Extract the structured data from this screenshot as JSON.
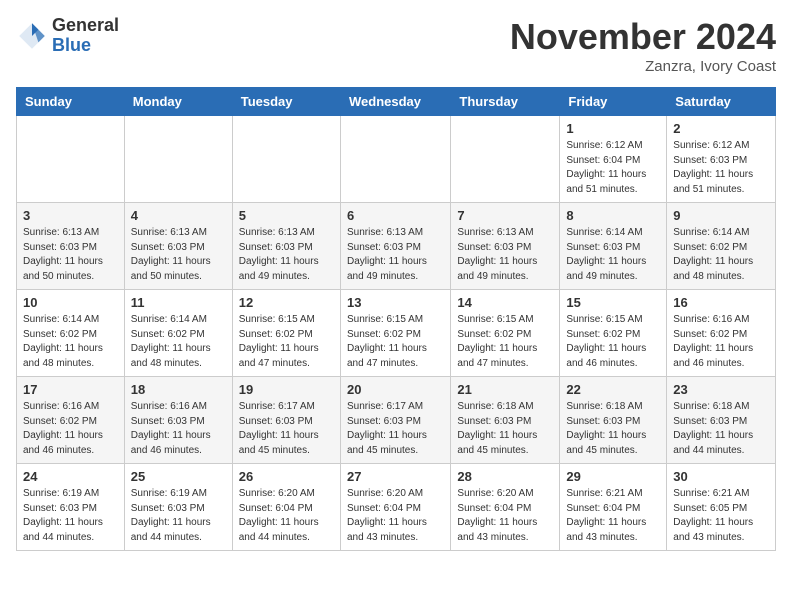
{
  "logo": {
    "general": "General",
    "blue": "Blue"
  },
  "title": "November 2024",
  "location": "Zanzra, Ivory Coast",
  "days_of_week": [
    "Sunday",
    "Monday",
    "Tuesday",
    "Wednesday",
    "Thursday",
    "Friday",
    "Saturday"
  ],
  "weeks": [
    [
      {
        "day": "",
        "info": ""
      },
      {
        "day": "",
        "info": ""
      },
      {
        "day": "",
        "info": ""
      },
      {
        "day": "",
        "info": ""
      },
      {
        "day": "",
        "info": ""
      },
      {
        "day": "1",
        "info": "Sunrise: 6:12 AM\nSunset: 6:04 PM\nDaylight: 11 hours\nand 51 minutes."
      },
      {
        "day": "2",
        "info": "Sunrise: 6:12 AM\nSunset: 6:03 PM\nDaylight: 11 hours\nand 51 minutes."
      }
    ],
    [
      {
        "day": "3",
        "info": "Sunrise: 6:13 AM\nSunset: 6:03 PM\nDaylight: 11 hours\nand 50 minutes."
      },
      {
        "day": "4",
        "info": "Sunrise: 6:13 AM\nSunset: 6:03 PM\nDaylight: 11 hours\nand 50 minutes."
      },
      {
        "day": "5",
        "info": "Sunrise: 6:13 AM\nSunset: 6:03 PM\nDaylight: 11 hours\nand 49 minutes."
      },
      {
        "day": "6",
        "info": "Sunrise: 6:13 AM\nSunset: 6:03 PM\nDaylight: 11 hours\nand 49 minutes."
      },
      {
        "day": "7",
        "info": "Sunrise: 6:13 AM\nSunset: 6:03 PM\nDaylight: 11 hours\nand 49 minutes."
      },
      {
        "day": "8",
        "info": "Sunrise: 6:14 AM\nSunset: 6:03 PM\nDaylight: 11 hours\nand 49 minutes."
      },
      {
        "day": "9",
        "info": "Sunrise: 6:14 AM\nSunset: 6:02 PM\nDaylight: 11 hours\nand 48 minutes."
      }
    ],
    [
      {
        "day": "10",
        "info": "Sunrise: 6:14 AM\nSunset: 6:02 PM\nDaylight: 11 hours\nand 48 minutes."
      },
      {
        "day": "11",
        "info": "Sunrise: 6:14 AM\nSunset: 6:02 PM\nDaylight: 11 hours\nand 48 minutes."
      },
      {
        "day": "12",
        "info": "Sunrise: 6:15 AM\nSunset: 6:02 PM\nDaylight: 11 hours\nand 47 minutes."
      },
      {
        "day": "13",
        "info": "Sunrise: 6:15 AM\nSunset: 6:02 PM\nDaylight: 11 hours\nand 47 minutes."
      },
      {
        "day": "14",
        "info": "Sunrise: 6:15 AM\nSunset: 6:02 PM\nDaylight: 11 hours\nand 47 minutes."
      },
      {
        "day": "15",
        "info": "Sunrise: 6:15 AM\nSunset: 6:02 PM\nDaylight: 11 hours\nand 46 minutes."
      },
      {
        "day": "16",
        "info": "Sunrise: 6:16 AM\nSunset: 6:02 PM\nDaylight: 11 hours\nand 46 minutes."
      }
    ],
    [
      {
        "day": "17",
        "info": "Sunrise: 6:16 AM\nSunset: 6:02 PM\nDaylight: 11 hours\nand 46 minutes."
      },
      {
        "day": "18",
        "info": "Sunrise: 6:16 AM\nSunset: 6:03 PM\nDaylight: 11 hours\nand 46 minutes."
      },
      {
        "day": "19",
        "info": "Sunrise: 6:17 AM\nSunset: 6:03 PM\nDaylight: 11 hours\nand 45 minutes."
      },
      {
        "day": "20",
        "info": "Sunrise: 6:17 AM\nSunset: 6:03 PM\nDaylight: 11 hours\nand 45 minutes."
      },
      {
        "day": "21",
        "info": "Sunrise: 6:18 AM\nSunset: 6:03 PM\nDaylight: 11 hours\nand 45 minutes."
      },
      {
        "day": "22",
        "info": "Sunrise: 6:18 AM\nSunset: 6:03 PM\nDaylight: 11 hours\nand 45 minutes."
      },
      {
        "day": "23",
        "info": "Sunrise: 6:18 AM\nSunset: 6:03 PM\nDaylight: 11 hours\nand 44 minutes."
      }
    ],
    [
      {
        "day": "24",
        "info": "Sunrise: 6:19 AM\nSunset: 6:03 PM\nDaylight: 11 hours\nand 44 minutes."
      },
      {
        "day": "25",
        "info": "Sunrise: 6:19 AM\nSunset: 6:03 PM\nDaylight: 11 hours\nand 44 minutes."
      },
      {
        "day": "26",
        "info": "Sunrise: 6:20 AM\nSunset: 6:04 PM\nDaylight: 11 hours\nand 44 minutes."
      },
      {
        "day": "27",
        "info": "Sunrise: 6:20 AM\nSunset: 6:04 PM\nDaylight: 11 hours\nand 43 minutes."
      },
      {
        "day": "28",
        "info": "Sunrise: 6:20 AM\nSunset: 6:04 PM\nDaylight: 11 hours\nand 43 minutes."
      },
      {
        "day": "29",
        "info": "Sunrise: 6:21 AM\nSunset: 6:04 PM\nDaylight: 11 hours\nand 43 minutes."
      },
      {
        "day": "30",
        "info": "Sunrise: 6:21 AM\nSunset: 6:05 PM\nDaylight: 11 hours\nand 43 minutes."
      }
    ]
  ]
}
